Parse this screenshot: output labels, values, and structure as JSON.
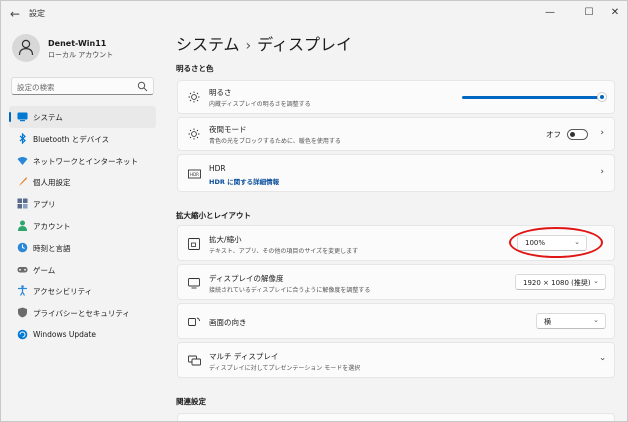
{
  "window": {
    "title": "設定",
    "minimize": "—",
    "maximize": "☐",
    "close": "✕"
  },
  "user": {
    "name": "Denet-Win11",
    "account_type": "ローカル アカウント"
  },
  "search": {
    "placeholder": "設定の検索"
  },
  "sidebar": {
    "items": [
      {
        "label": "システム",
        "icon": "monitor-icon",
        "color": "#0078d4"
      },
      {
        "label": "Bluetooth とデバイス",
        "icon": "bluetooth-icon",
        "color": "#0078d4"
      },
      {
        "label": "ネットワークとインターネット",
        "icon": "wifi-icon",
        "color": "#2b88d8"
      },
      {
        "label": "個人用設定",
        "icon": "brush-icon",
        "color": "#e3822d"
      },
      {
        "label": "アプリ",
        "icon": "apps-icon",
        "color": "#5a6b8c"
      },
      {
        "label": "アカウント",
        "icon": "person-icon",
        "color": "#2ea66b"
      },
      {
        "label": "時刻と言語",
        "icon": "globe-clock-icon",
        "color": "#2b88d8"
      },
      {
        "label": "ゲーム",
        "icon": "gamepad-icon",
        "color": "#6b6b6b"
      },
      {
        "label": "アクセシビリティ",
        "icon": "accessibility-icon",
        "color": "#2b88d8"
      },
      {
        "label": "プライバシーとセキュリティ",
        "icon": "shield-icon",
        "color": "#6b6b6b"
      },
      {
        "label": "Windows Update",
        "icon": "update-icon",
        "color": "#0078d4"
      }
    ],
    "active_index": 0
  },
  "breadcrumb": {
    "parent": "システム",
    "separator": "›",
    "current": "ディスプレイ"
  },
  "sections": {
    "brightness_color": "明るさと色",
    "scale_layout": "拡大縮小とレイアウト",
    "related": "関連設定"
  },
  "brightness": {
    "title": "明るさ",
    "description": "内蔵ディスプレイの明るさを調整する",
    "level_percent": 100
  },
  "night_light": {
    "title": "夜間モード",
    "description": "青色の光をブロックするために、暖色を使用する",
    "state_label": "オフ"
  },
  "hdr": {
    "title": "HDR",
    "link": "HDR に関する詳細情報"
  },
  "scale": {
    "title": "拡大/縮小",
    "description": "テキスト、アプリ、その他の項目のサイズを変更します",
    "value": "100%"
  },
  "resolution": {
    "title": "ディスプレイの解像度",
    "description": "接続されているディスプレイに合うように解像度を調整する",
    "value": "1920 × 1080 (推奨)"
  },
  "orientation": {
    "title": "画面の向き",
    "value": "横"
  },
  "multi_display": {
    "title": "マルチ ディスプレイ",
    "description": "ディスプレイに対してプレゼンテーション モードを選択"
  },
  "accent_color": "#0067c0",
  "annotation_color": "#e01515"
}
